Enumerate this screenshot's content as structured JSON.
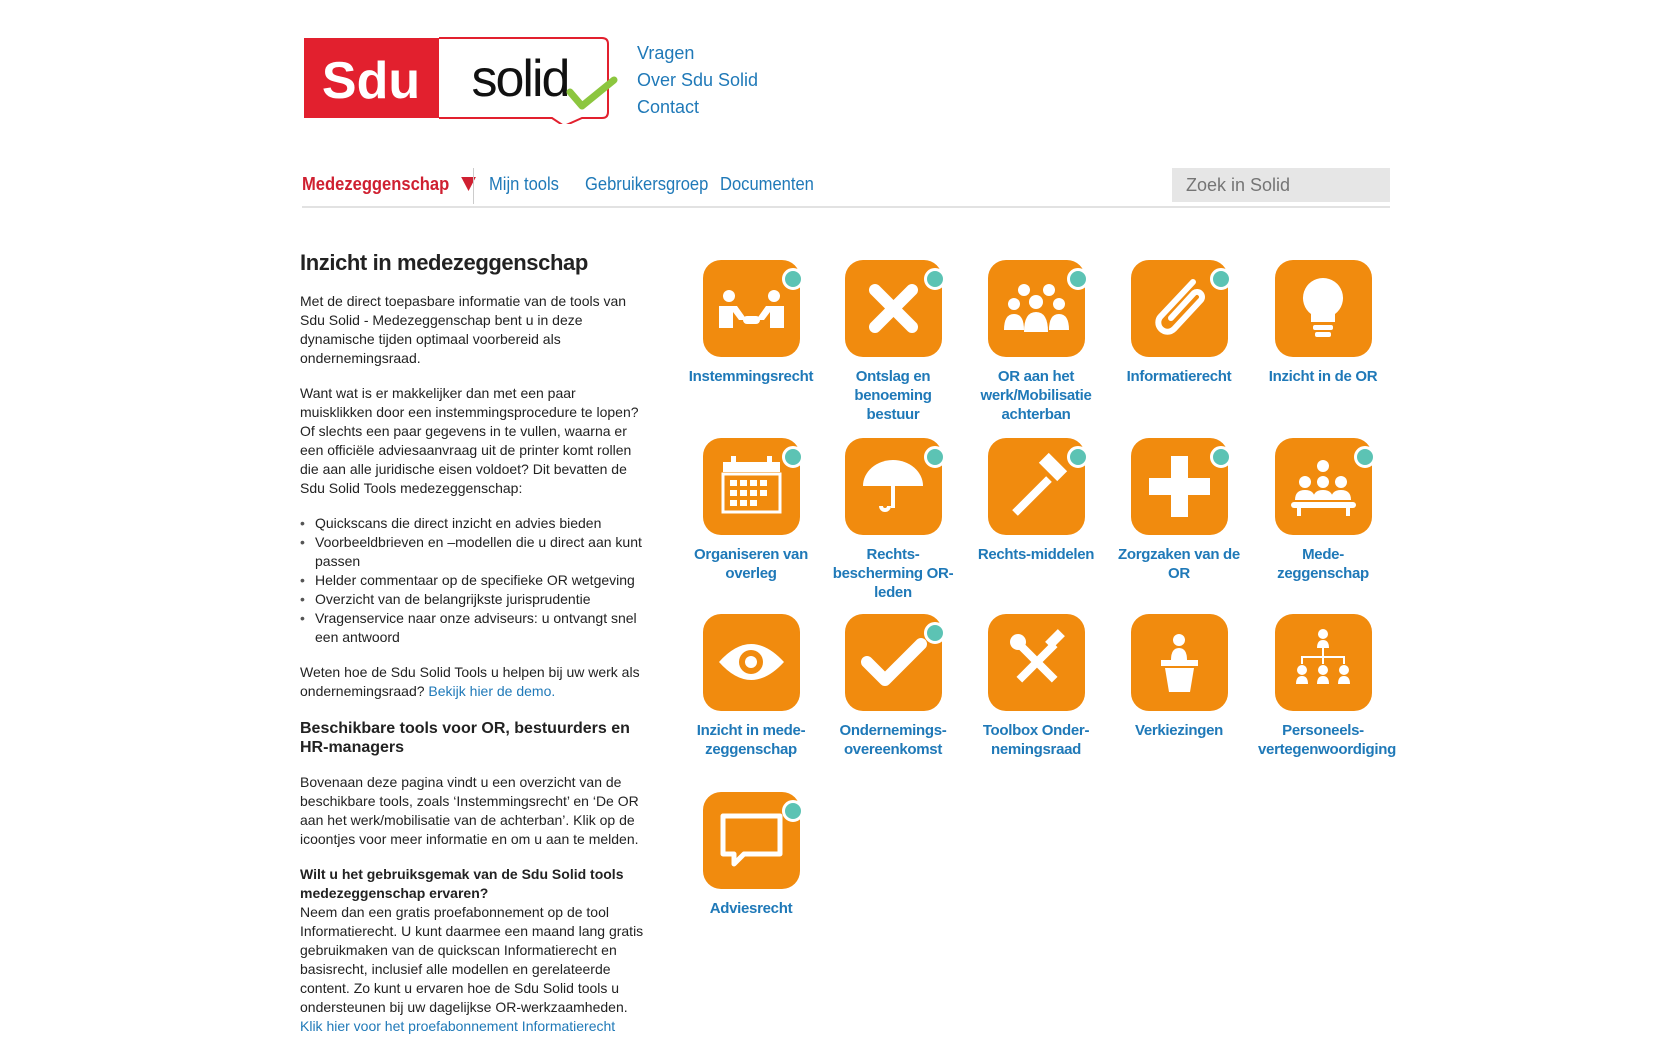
{
  "brand": {
    "logo_text_left": "Sdu",
    "logo_text_right": "solid",
    "red": "#e2202e",
    "orange": "#f18b0e",
    "teal": "#5cc3b4",
    "link_blue": "#1f79b8",
    "check_green": "#8cc63f"
  },
  "top_links": [
    "Vragen",
    "Over Sdu Solid",
    "Contact"
  ],
  "nav": {
    "active": "Medezeggenschap",
    "items": [
      "Mijn tools",
      "Gebruikersgroep",
      "Documenten"
    ],
    "search_placeholder": "Zoek in Solid"
  },
  "content": {
    "title": "Inzicht in medezeggenschap",
    "p1": "Met de direct toepasbare informatie van de tools van Sdu Solid - Medezeggenschap bent u in deze dynamische tijden optimaal voorbereid als ondernemingsraad.",
    "p2": "Want wat is er makkelijker dan met een paar muisklikken door een instemmingsprocedure te lopen? Of slechts een paar gegevens in te vullen, waarna er een officiële adviesaanvraag uit de printer komt rollen die aan alle juridische eisen voldoet? Dit bevatten de Sdu Solid Tools medezeggenschap:",
    "bullets": [
      "Quickscans die direct inzicht en advies bieden",
      "Voorbeeldbrieven en –modellen die u direct aan kunt passen",
      "Helder commentaar op de specifieke OR wetgeving",
      "Overzicht van de belangrijkste jurisprudentie",
      "Vragenservice naar onze adviseurs: u ontvangt snel een antwoord"
    ],
    "p3": "Weten hoe de Sdu Solid Tools u helpen bij uw werk als ondernemingsraad?",
    "p3_link": "Bekijk hier de demo.",
    "h2": "Beschikbare tools voor OR, bestuurders en HR-managers",
    "p4": "Bovenaan deze pagina vindt u een overzicht van de beschikbare tools, zoals ‘Instemmingsrecht’ en ‘De OR aan het werk/mobilisatie van de achterban’. Klik op de icoontjes voor meer informatie en om u aan te melden.",
    "h3": "Wilt u het gebruiksgemak van de Sdu Solid tools medezeggenschap ervaren?",
    "p5": "Neem dan een gratis proefabonnement op de tool Informatierecht. U kunt daarmee een maand lang gratis gebruikmaken van de quickscan Informatierecht en basisrecht, inclusief alle modellen en gerelateerde content. Zo kunt u ervaren hoe de Sdu Solid tools u ondersteunen bij uw dagelijkse OR-werkzaamheden.",
    "p5_link": "Klik hier voor het proefabonnement Informatierecht"
  },
  "tools": [
    {
      "label": "Instemmingsrecht",
      "icon": "handshake-icon",
      "dot": true
    },
    {
      "label": "Ontslag en benoeming bestuur",
      "icon": "cross-icon",
      "dot": true
    },
    {
      "label": "OR aan het werk/Mobilisatie achterban",
      "icon": "group-icon",
      "dot": true
    },
    {
      "label": "Informatierecht",
      "icon": "paperclip-icon",
      "dot": true
    },
    {
      "label": "Inzicht in de OR",
      "icon": "lightbulb-icon",
      "dot": false
    },
    {
      "label": "Organiseren van overleg",
      "icon": "calendar-icon",
      "dot": true
    },
    {
      "label": "Rechts-bescherming OR-leden",
      "icon": "umbrella-icon",
      "dot": true
    },
    {
      "label": "Rechts-middelen",
      "icon": "hammer-icon",
      "dot": true
    },
    {
      "label": "Zorgzaken van de OR",
      "icon": "plus-icon",
      "dot": true
    },
    {
      "label": "Mede-zeggenschap",
      "icon": "meeting-icon",
      "dot": true
    },
    {
      "label": "Inzicht in mede-zeggenschap",
      "icon": "eye-icon",
      "dot": false
    },
    {
      "label": "Ondernemings-overeenkomst",
      "icon": "checkmark-icon",
      "dot": true
    },
    {
      "label": "Toolbox Onder-nemingsraad",
      "icon": "tools-icon",
      "dot": false
    },
    {
      "label": "Verkiezingen",
      "icon": "podium-icon",
      "dot": false
    },
    {
      "label": "Personeels-vertegenwoordiging",
      "icon": "org-chart-icon",
      "dot": false
    },
    {
      "label": "Adviesrecht",
      "icon": "speech-bubble-icon",
      "dot": true
    }
  ]
}
